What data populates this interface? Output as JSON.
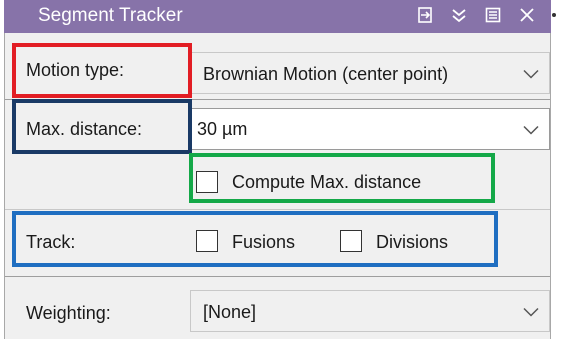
{
  "window": {
    "title": "Segment Tracker",
    "buttons": [
      "pin-icon",
      "dropdown-icon",
      "panel-icon",
      "close-icon"
    ]
  },
  "rows": {
    "motion_type": {
      "label": "Motion type:",
      "value": "Brownian Motion (center point)"
    },
    "max_distance": {
      "label": "Max. distance:",
      "value": "30 µm"
    },
    "compute": {
      "label": "Compute Max. distance",
      "checked": false
    },
    "track": {
      "label": "Track:",
      "fusions_label": "Fusions",
      "fusions_checked": false,
      "divisions_label": "Divisions",
      "divisions_checked": false
    },
    "weighting": {
      "label": "Weighting:",
      "value": "[None]"
    }
  },
  "highlight_colors": {
    "motion_type": "#e21d24",
    "max_distance": "#1a3a66",
    "compute": "#14a848",
    "track": "#1f6ec1"
  },
  "accent": "#8773a9"
}
